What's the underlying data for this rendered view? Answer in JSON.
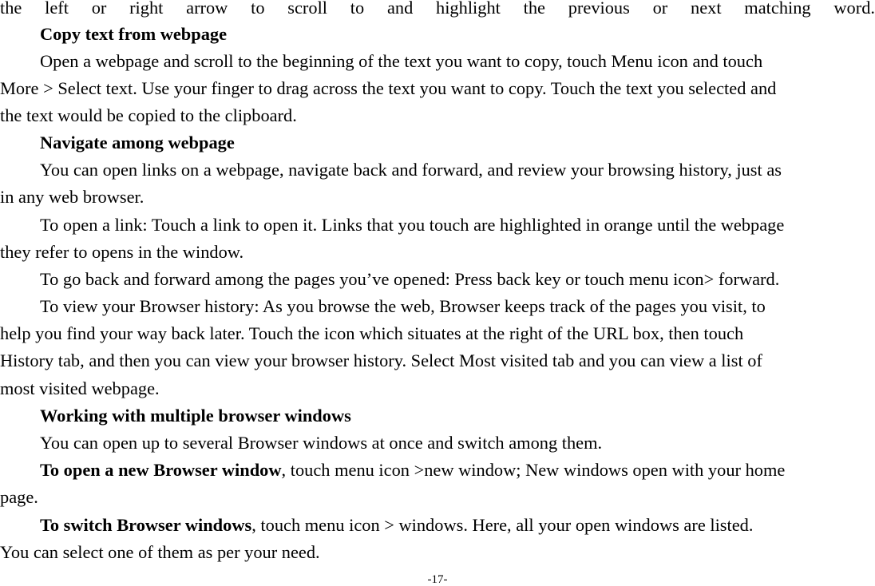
{
  "document": {
    "lines": [
      {
        "text": "the left or right arrow to scroll to and highlight the previous or next matching word."
      },
      {
        "heading": "Copy text from webpage"
      },
      {
        "text": "Open a webpage and scroll to the beginning of the text you want to copy, touch Menu icon and touch"
      },
      {
        "text": "More > Select text. Use your finger to drag across the text you want to copy. Touch the text you selected and"
      },
      {
        "text": "the text would be copied to the clipboard."
      },
      {
        "heading": "Navigate among webpage"
      },
      {
        "text": "You can open links on a webpage, navigate back and forward, and review your browsing history, just as"
      },
      {
        "text": "in any web browser."
      },
      {
        "text": "To open a link: Touch a link to open it. Links that you touch are highlighted in orange until the webpage"
      },
      {
        "text": "they refer to opens in the window."
      },
      {
        "text": "To go back and forward among the pages you’ve opened: Press back key or touch menu icon> forward."
      },
      {
        "text": "To view your Browser history: As you browse the web, Browser keeps track of the pages you visit, to"
      },
      {
        "text": "help you find your way back later. Touch the icon which situates at the right of the URL box, then touch"
      },
      {
        "text": "History tab, and then you can view your browser history. Select Most visited tab and you can view a list of"
      },
      {
        "text": "most visited webpage."
      },
      {
        "heading": "Working with multiple browser windows"
      },
      {
        "text": "You can open up to several Browser windows at once and switch among them."
      },
      {
        "bold": "To open a new Browser window",
        "text": ", touch menu icon >new window; New windows open with your home"
      },
      {
        "text": "page."
      },
      {
        "bold": "To switch Browser windows",
        "text": ", touch menu icon > windows. Here, all your open windows are listed."
      },
      {
        "text": "You can select one of them as per your need."
      }
    ],
    "page_number": "-17-"
  }
}
